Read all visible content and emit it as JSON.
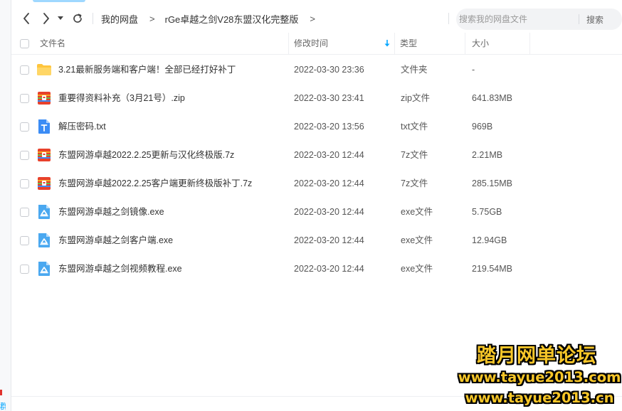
{
  "breadcrumb": [
    "我的网盘",
    "rGe卓越之剑V28东盟汉化完整版"
  ],
  "breadcrumb_separator": ">",
  "search": {
    "placeholder": "搜索我的网盘文件",
    "button_label": "搜索"
  },
  "columns": {
    "name": "文件名",
    "modified": "修改时间",
    "type": "类型",
    "size": "大小"
  },
  "sort": {
    "column": "modified",
    "direction": "desc"
  },
  "files": [
    {
      "icon": "folder-icon",
      "name": "3.21最新服务端和客户端！全部已经打好补丁",
      "modified": "2022-03-30 23:36",
      "type": "文件夹",
      "size": "-"
    },
    {
      "icon": "zip-archive-icon",
      "name": "重要得资料补充（3月21号）.zip",
      "modified": "2022-03-30 23:41",
      "type": "zip文件",
      "size": "641.83MB"
    },
    {
      "icon": "text-file-icon",
      "name": "解压密码.txt",
      "modified": "2022-03-20 13:56",
      "type": "txt文件",
      "size": "969B"
    },
    {
      "icon": "zip-archive-icon",
      "name": "东盟网游卓越2022.2.25更新与汉化终极版.7z",
      "modified": "2022-03-20 12:44",
      "type": "7z文件",
      "size": "2.21MB"
    },
    {
      "icon": "zip-archive-icon",
      "name": "东盟网游卓越2022.2.25客户端更新终极版补丁.7z",
      "modified": "2022-03-20 12:44",
      "type": "7z文件",
      "size": "285.15MB"
    },
    {
      "icon": "exe-file-icon",
      "name": "东盟网游卓越之剑镜像.exe",
      "modified": "2022-03-20 12:44",
      "type": "exe文件",
      "size": "5.75GB"
    },
    {
      "icon": "exe-file-icon",
      "name": "东盟网游卓越之剑客户端.exe",
      "modified": "2022-03-20 12:44",
      "type": "exe文件",
      "size": "12.94GB"
    },
    {
      "icon": "exe-file-icon",
      "name": "东盟网游卓越之剑视频教程.exe",
      "modified": "2022-03-20 12:44",
      "type": "exe文件",
      "size": "219.54MB"
    }
  ],
  "sidebar_cut_text": "群",
  "watermark": {
    "title": "踏月网单论坛",
    "url1": "www.tayue2013.com",
    "url2": "www.tayue2013.cn"
  },
  "colors": {
    "accent": "#06a7ff",
    "folder": "#ffc53d",
    "zip": "#e8412c",
    "txt": "#3b8cf5",
    "exe": "#4aa8f0",
    "watermark": "#f7c628"
  }
}
